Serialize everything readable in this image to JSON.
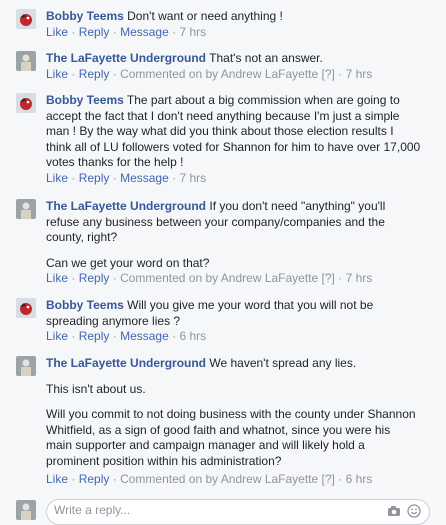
{
  "comments": [
    {
      "author": "Bobby Teems",
      "avatar": "red-bird-avatar",
      "lines": [
        "Don't want or need anything !"
      ],
      "actions": [
        "Like",
        "Reply",
        "Message"
      ],
      "time": "7 hrs"
    },
    {
      "author": "The LaFayette Underground",
      "avatar": "statue-avatar",
      "lines": [
        "That's not an answer."
      ],
      "actions": [
        "Like",
        "Reply"
      ],
      "commented_on_by": "Commented on by Andrew LaFayette",
      "badge": "[?]",
      "time": "7 hrs"
    },
    {
      "author": "Bobby Teems",
      "avatar": "red-bird-avatar",
      "first_line": "The part about a big commission when are going to",
      "lines": [
        "accept the fact that I don't need anything because I'm just a simple",
        "man ! By the way what did you think about those election results I",
        "think all of LU followers voted for Shannon for him to have over 17,000",
        "votes thanks for the help !"
      ],
      "actions": [
        "Like",
        "Reply",
        "Message"
      ],
      "time": "7 hrs"
    },
    {
      "author": "The LaFayette Underground",
      "avatar": "statue-avatar",
      "first_line": "If you don't need \"anything\" you'll",
      "lines": [
        "refuse any business between your company/companies and the",
        "county, right?"
      ],
      "paragraph": "Can we get your word on that?",
      "actions": [
        "Like",
        "Reply"
      ],
      "commented_on_by": "Commented on by Andrew LaFayette",
      "badge": "[?]",
      "time": "7 hrs"
    },
    {
      "author": "Bobby Teems",
      "avatar": "red-bird-avatar",
      "first_line": "Will you give me your word that you will not be",
      "lines": [
        "spreading anymore lies ?"
      ],
      "actions": [
        "Like",
        "Reply",
        "Message"
      ],
      "time": "6 hrs"
    },
    {
      "author": "The LaFayette Underground",
      "avatar": "statue-avatar",
      "first_line": "We haven't spread any lies.",
      "paragraphs": [
        [
          "This isn't about us."
        ],
        [
          "Will you commit to not doing business with the county under Shannon",
          "Whitfield, as a sign of good faith and whatnot, since you were his",
          "main supporter and campaign manager and will likely hold a",
          "prominent position within his administration?"
        ]
      ],
      "actions": [
        "Like",
        "Reply"
      ],
      "commented_on_by": "Commented on by Andrew LaFayette",
      "badge": "[?]",
      "time": "6 hrs"
    }
  ],
  "reply_box": {
    "placeholder": "Write a reply...",
    "icons": [
      "camera-icon",
      "emoji-icon"
    ]
  }
}
